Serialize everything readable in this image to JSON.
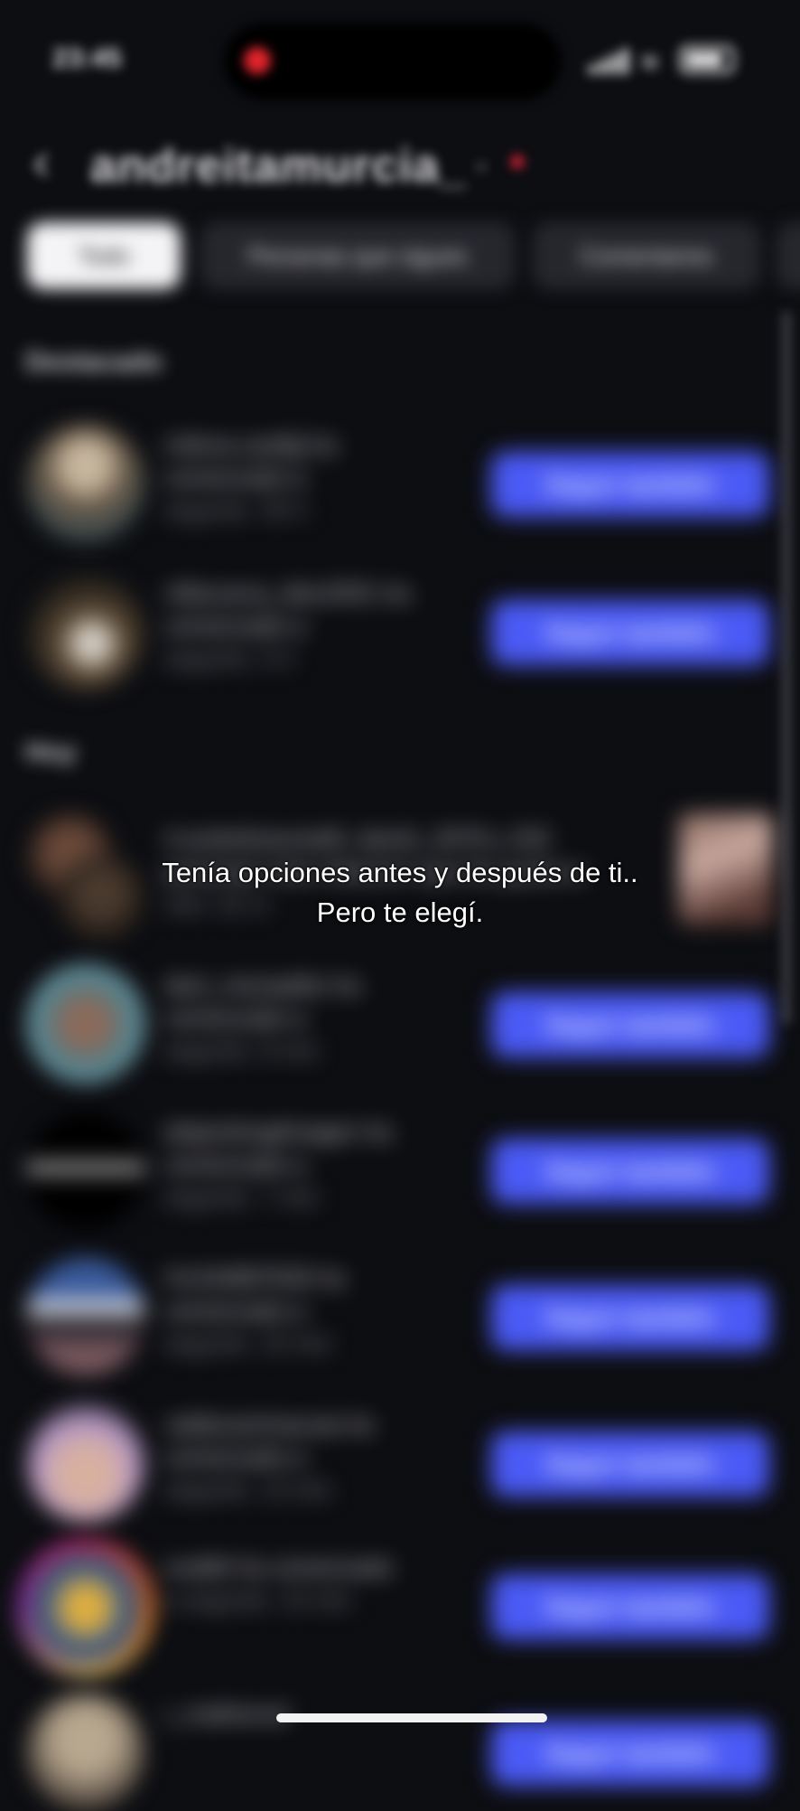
{
  "status_bar": {
    "time": "23:45",
    "icons": [
      "recording-dot-icon",
      "signal-icon",
      "wifi-icon",
      "battery-icon"
    ]
  },
  "header": {
    "username": "andreitamurcia_",
    "back_icon": "chevron-left-icon",
    "dropdown_icon": "chevron-down-icon"
  },
  "tabs": [
    {
      "label": "Todo",
      "active": true
    },
    {
      "label": "Personas que sigues",
      "active": false
    },
    {
      "label": "Comentarios",
      "active": false
    }
  ],
  "sections": {
    "featured": "Destacado",
    "today": "Hoy"
  },
  "rows": [
    {
      "line1": "milena.castiljj ha",
      "line2": "comenzado a",
      "line3": "seguirte. 40 h",
      "button": "Seguir también"
    },
    {
      "line1": "villanueva_diez2001 ha",
      "line2": "comenzado a",
      "line3": "seguirte. 5 h",
      "button": "Seguir también"
    },
    {
      "line1": "A andrelizanneit6, danit1_0078 y 202",
      "line2": "personas más indicaron que les gusta tu",
      "line3": "reel. 42 m",
      "button": ""
    },
    {
      "line1": "dani_mezaatiks ha",
      "line2": "comenzado a",
      "line3": "seguirte. 8 min",
      "button": "Seguir también"
    },
    {
      "line1": "alejandrogdmagen ha",
      "line2": "comenzado a",
      "line3": "seguirte. 7 min",
      "button": "Seguir también"
    },
    {
      "line1": "H1434897635 ha",
      "line2": "comenzado a",
      "line3": "seguirte. 10 min",
      "button": "Seguir también"
    },
    {
      "line1": "valdezanimacuta ha",
      "line2": "comenzado a",
      "line3": "seguirte. 13 min",
      "button": "Seguir también"
    },
    {
      "line1": "ovalfel ha comenzado",
      "line2": "a seguirte. 10 min",
      "line3": "",
      "button": "Seguir también"
    },
    {
      "line1": "r_mathersol",
      "line2": "",
      "line3": "",
      "button": "Seguir también"
    }
  ],
  "caption": {
    "line1": "Tenía opciones antes y después de ti..",
    "line2": "Pero te elegí."
  },
  "colors": {
    "accent": "#4a5af5",
    "background": "#0d0e12",
    "story_ring": "#d62976"
  }
}
